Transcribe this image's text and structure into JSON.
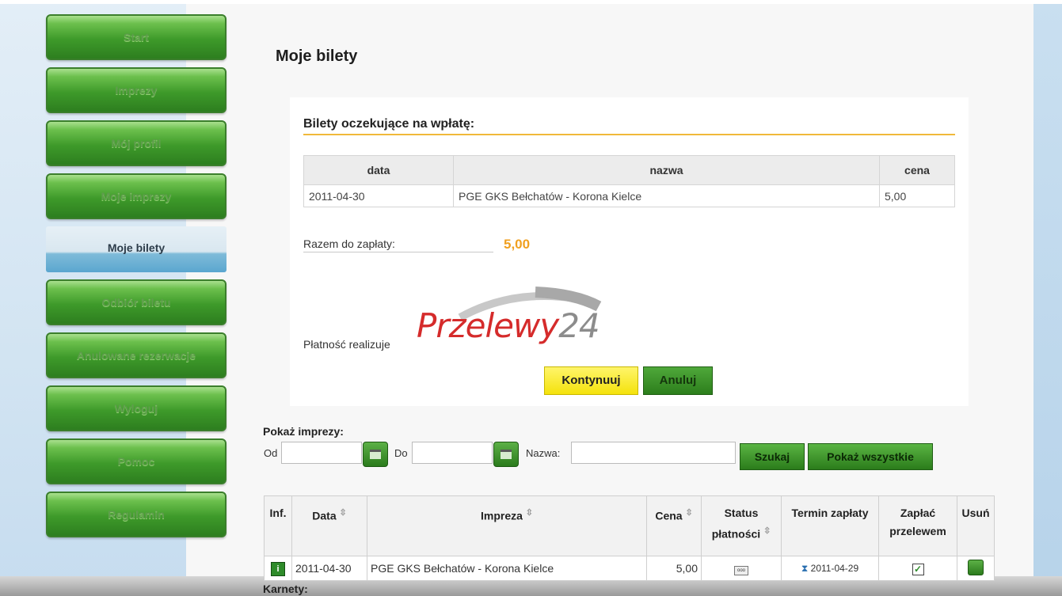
{
  "nav": {
    "items": [
      {
        "label": "Start"
      },
      {
        "label": "Imprezy"
      },
      {
        "label": "Mój profil"
      },
      {
        "label": "Moje imprezy"
      },
      {
        "label": "Moje bilety"
      },
      {
        "label": "Odbiór biletu"
      },
      {
        "label": "Anulowane rezerwacje"
      },
      {
        "label": "Wyloguj"
      },
      {
        "label": "Pomoc"
      },
      {
        "label": "Regulamin"
      }
    ],
    "active_label": "Moje bilety"
  },
  "page": {
    "title": "Moje bilety"
  },
  "pending": {
    "heading": "Bilety oczekujące na wpłatę:",
    "columns": [
      "data",
      "nazwa",
      "cena"
    ],
    "rows": [
      {
        "date": "2011-04-30",
        "name": "PGE GKS Bełchatów - Korona Kielce",
        "price": "5,00"
      }
    ],
    "total_label": "Razem do zapłaty:",
    "total_value": "5,00",
    "payment_label": "Płatność realizuje",
    "provider_name": "Przelewy",
    "provider_number": "24",
    "continue_label": "Kontynuuj",
    "cancel_label": "Anuluj"
  },
  "filter": {
    "title": "Pokaż imprezy:",
    "from_label": "Od",
    "from_value": "",
    "to_label": "Do",
    "to_value": "",
    "name_label": "Nazwa:",
    "name_value": "",
    "search_label": "Szukaj",
    "show_all_label": "Pokaż wszystkie"
  },
  "events": {
    "headers": {
      "info": "Inf.",
      "date": "Data",
      "event": "Impreza",
      "price": "Cena",
      "status_line1": "Status",
      "status_line2": "płatności",
      "due": "Termin zapłaty",
      "pay_line1": "Zapłać",
      "pay_line2": "przelewem",
      "delete": "Usuń"
    },
    "rows": [
      {
        "info_icon": "i",
        "date": "2011-04-30",
        "event": "PGE GKS Bełchatów - Korona Kielce",
        "price": "5,00",
        "status_icon": "ooo",
        "due": "2011-04-29",
        "pay_checked": "✓"
      }
    ]
  },
  "season_tickets": {
    "heading": "Karnety:"
  },
  "colors": {
    "accent_green": "#3e9a2a",
    "highlight_orange": "#f0a020",
    "logo_red": "#d52b2b",
    "rule": "#f0b93a"
  }
}
